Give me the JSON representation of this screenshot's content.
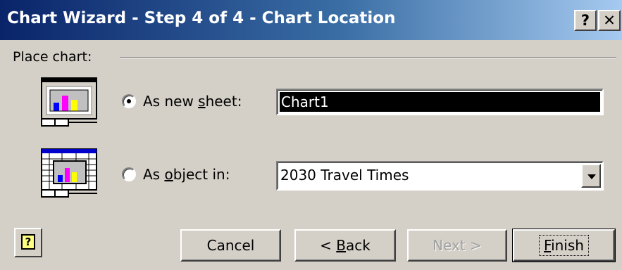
{
  "window": {
    "title": "Chart Wizard - Step 4 of 4 - Chart Location",
    "help_glyph": "?",
    "close_glyph": "✕"
  },
  "group": {
    "label": "Place chart:"
  },
  "options": {
    "new_sheet": {
      "label_pre": "As new ",
      "label_key": "s",
      "label_post": "heet:",
      "value": "Chart1",
      "selected": true
    },
    "as_object": {
      "label_pre": "As ",
      "label_key": "o",
      "label_post": "bject in:",
      "value": "2030 Travel Times",
      "selected": false
    }
  },
  "buttons": {
    "cancel": "Cancel",
    "back_pre": "< ",
    "back_key": "B",
    "back_post": "ack",
    "next": "Next >",
    "finish_key": "F",
    "finish_post": "inish"
  },
  "icons": {
    "help_button": "help-icon",
    "new_sheet": "chart-sheet-icon",
    "as_object": "embedded-chart-icon"
  },
  "colors": {
    "title_start": "#0a246a",
    "title_end": "#a6caf0",
    "face": "#d4d0c8"
  }
}
